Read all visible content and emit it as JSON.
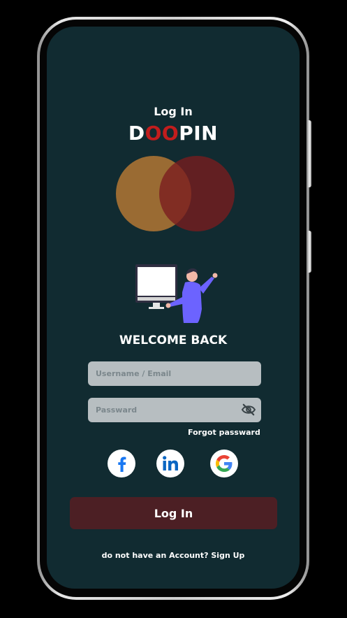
{
  "header": {
    "title": "Log In",
    "brand": {
      "before": "D",
      "accent": "OO",
      "after": "PIN"
    }
  },
  "welcome": "WELCOME BACK",
  "form": {
    "username": {
      "placeholder": "Username / Email",
      "value": ""
    },
    "password": {
      "placeholder": "Passward",
      "value": ""
    },
    "forgot_label": "Forgot passward",
    "submit_label": "Log In"
  },
  "social": [
    {
      "icon": "facebook-icon",
      "color": "#1877f2"
    },
    {
      "icon": "linkedin-icon",
      "color": "#0a66c2"
    },
    {
      "icon": "google-icon",
      "color": "#4285f4"
    }
  ],
  "footer": {
    "prompt": "do not have an Account?",
    "link": "Sign Up"
  },
  "colors": {
    "background": "#112b31",
    "accent": "#c21d1d",
    "button": "#4c1f24",
    "field": "#b7bec1"
  }
}
